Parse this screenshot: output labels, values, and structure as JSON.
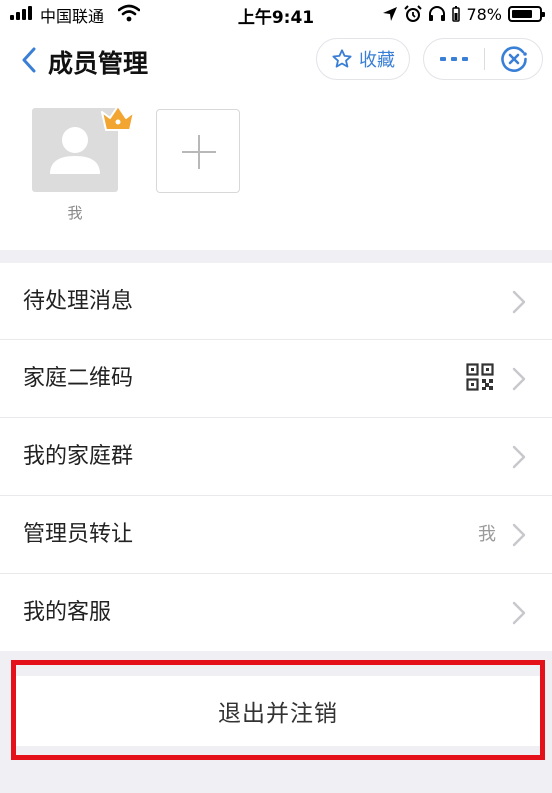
{
  "status_bar": {
    "carrier": "中国联通",
    "time": "上午9:41",
    "battery": "78%",
    "battery_level": 0.78
  },
  "nav": {
    "title": "成员管理",
    "favorite_label": "收藏"
  },
  "members": [
    {
      "name": "我",
      "is_admin": true
    }
  ],
  "menu": {
    "items": [
      {
        "label": "待处理消息"
      },
      {
        "label": "家庭二维码",
        "icon": "qr-code-icon"
      },
      {
        "label": "我的家庭群"
      },
      {
        "label": "管理员转让",
        "value": "我"
      },
      {
        "label": "我的客服"
      }
    ]
  },
  "logout": {
    "label": "退出并注销"
  },
  "colors": {
    "accent": "#3a7fd6",
    "highlight_frame": "#e4111b",
    "crown": "#f2a530"
  }
}
